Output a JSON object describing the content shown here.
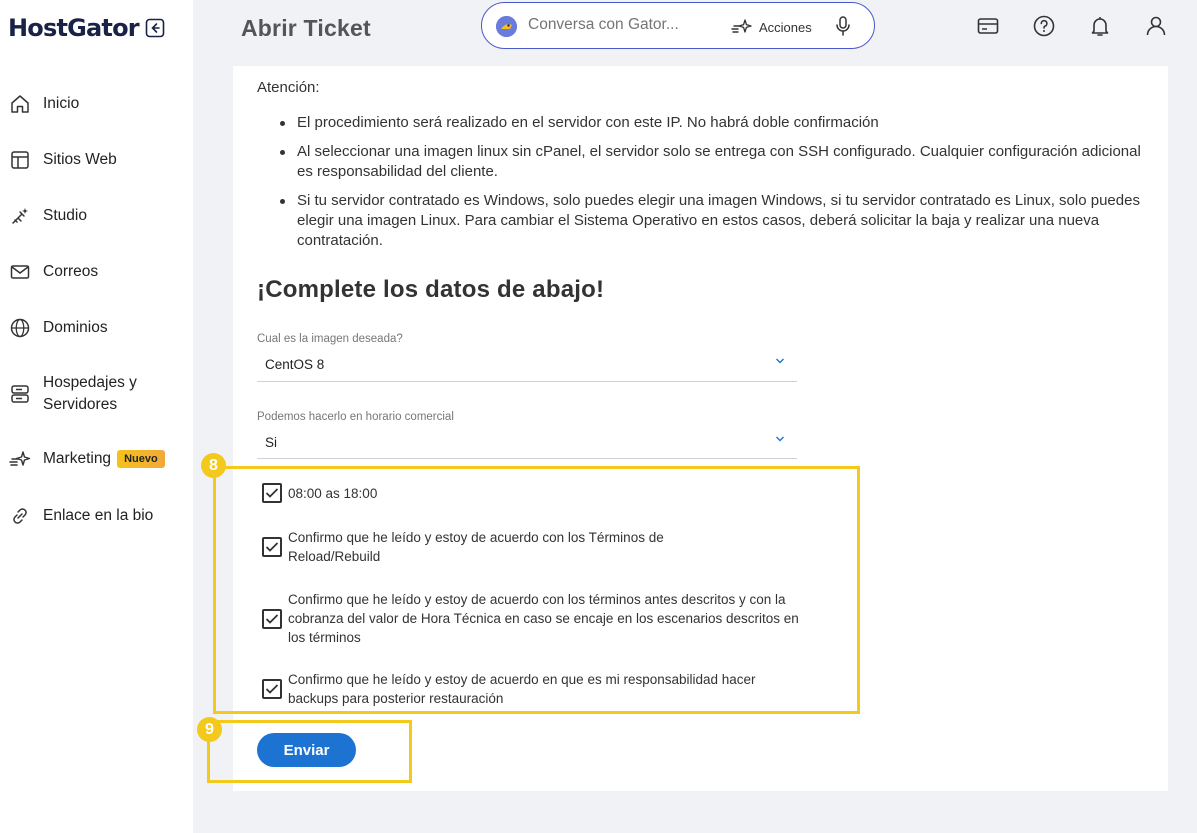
{
  "brand": {
    "logo_text": "HostGator"
  },
  "sidebar": {
    "items": [
      {
        "label": "Inicio",
        "icon": "home-icon"
      },
      {
        "label": "Sitios Web",
        "icon": "layout-icon"
      },
      {
        "label": "Studio",
        "icon": "magic-brush-icon"
      },
      {
        "label": "Correos",
        "icon": "mail-icon"
      },
      {
        "label": "Dominios",
        "icon": "globe-icon"
      },
      {
        "label": "Hospedajes y Servidores",
        "icon": "server-icon"
      },
      {
        "label": "Marketing",
        "icon": "sparkle-arrow-icon",
        "badge": "Nuevo"
      },
      {
        "label": "Enlace en la bio",
        "icon": "link-icon"
      }
    ]
  },
  "header": {
    "title": "Abrir Ticket",
    "search_placeholder": "Conversa con Gator...",
    "actions_label": "Acciones"
  },
  "content": {
    "attention_title": "Atención:",
    "bullets": [
      "El procedimiento será realizado en el servidor con este IP. No habrá doble confirmación",
      "Al seleccionar una imagen linux sin cPanel, el servidor solo se entrega con SSH configurado. Cualquier configuración adicional es responsabilidad del cliente.",
      "Si tu servidor contratado es Windows, solo puedes elegir una imagen Windows, si tu servidor contratado es Linux, solo puedes elegir una imagen Linux. Para cambiar el Sistema Operativo en estos casos, deberá solicitar la baja y realizar una nueva contratación."
    ],
    "section_title": "¡Complete los datos de abajo!",
    "image_field": {
      "label": "Cual es la imagen deseada?",
      "value": "CentOS 8"
    },
    "hours_field": {
      "label": "Podemos hacerlo en horario comercial",
      "value": "Si"
    },
    "checkboxes": [
      {
        "label": "08:00 as 18:00",
        "checked": true
      },
      {
        "label": "Confirmo que he leído y estoy de acuerdo con los Términos de Reload/Rebuild",
        "checked": true
      },
      {
        "label": "Confirmo que he leído y estoy de acuerdo con los términos antes descritos y con la cobranza del valor de Hora Técnica en caso se encaje en los escenarios descritos en los términos",
        "checked": true
      },
      {
        "label": "Confirmo que he leído y estoy de acuerdo en que es mi responsabilidad hacer backups para posterior restauración",
        "checked": true
      }
    ],
    "submit_label": "Enviar"
  },
  "annotations": {
    "step_8": "8",
    "step_9": "9",
    "highlight_color": "#f3c91c"
  },
  "colors": {
    "primary": "#1c73d2",
    "brand_dark": "#1b2248",
    "badge": "#f5c21b"
  }
}
